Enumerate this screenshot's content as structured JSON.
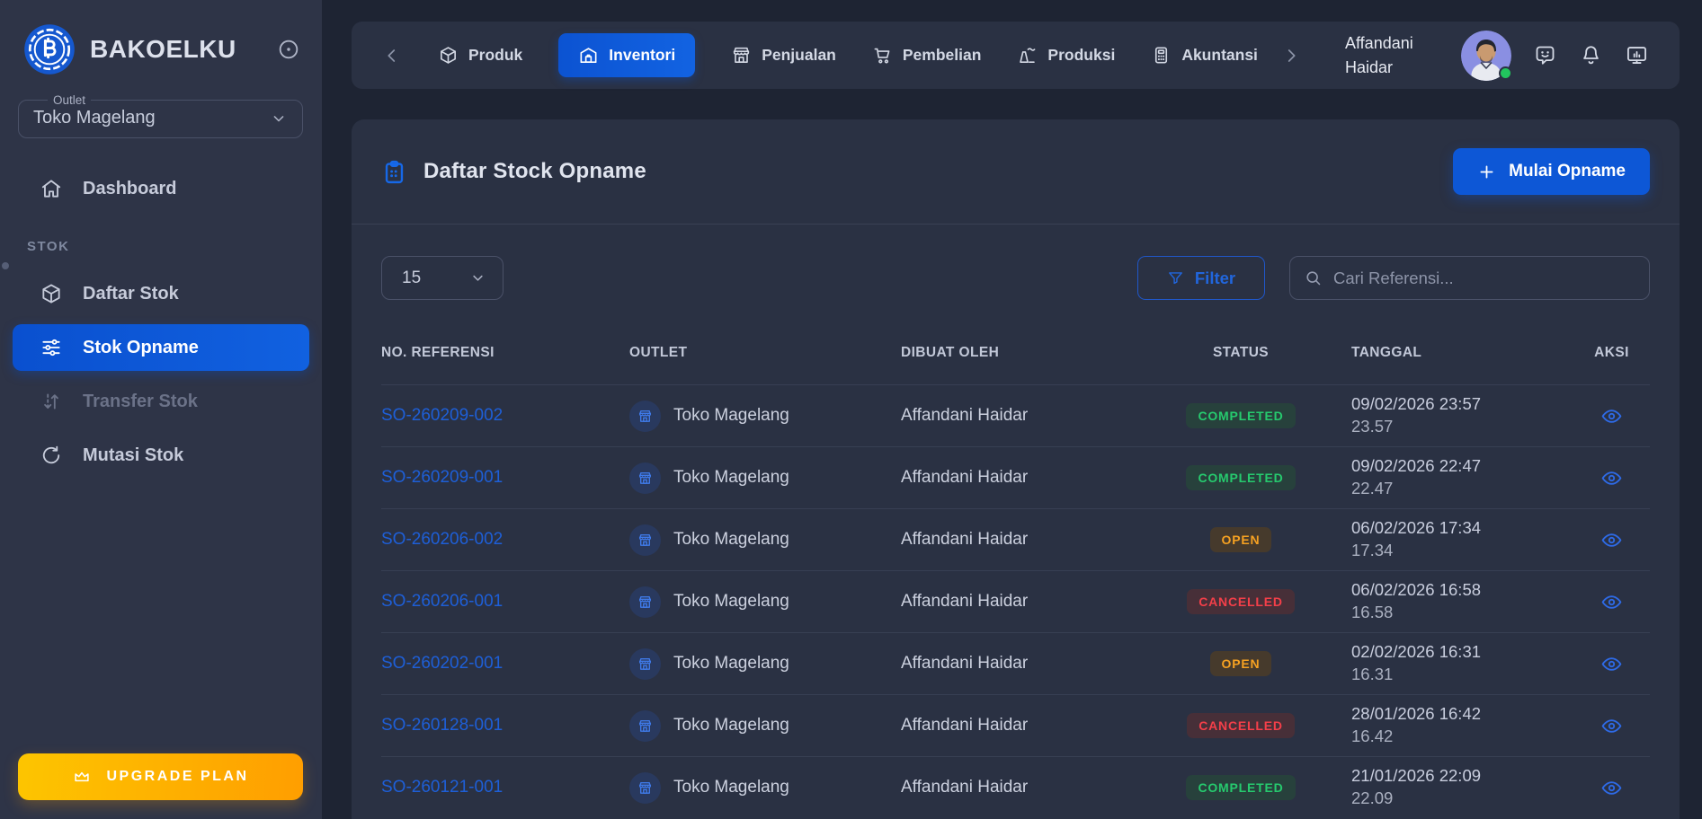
{
  "brand": {
    "name": "BAKOELKU"
  },
  "sidebar": {
    "outlet": {
      "label": "Outlet",
      "value": "Toko Magelang",
      "icon": "chevron-down-icon"
    },
    "dashboard": {
      "label": "Dashboard",
      "icon": "home-icon",
      "state": "default"
    },
    "section_label": "STOK",
    "items": [
      {
        "label": "Daftar Stok",
        "icon": "cube-icon",
        "state": "default"
      },
      {
        "label": "Stok Opname",
        "icon": "sliders-icon",
        "state": "active"
      },
      {
        "label": "Transfer Stok",
        "icon": "transfer-icon",
        "state": "disabled"
      },
      {
        "label": "Mutasi Stok",
        "icon": "refresh-icon",
        "state": "default"
      }
    ],
    "upgrade_label": "UPGRADE PLAN",
    "upgrade_icon": "crown-icon"
  },
  "topnav": {
    "items": [
      {
        "label": "Produk",
        "icon": "cube-icon",
        "active": false
      },
      {
        "label": "Inventori",
        "icon": "warehouse-icon",
        "active": true
      },
      {
        "label": "Penjualan",
        "icon": "storefront-icon",
        "active": false
      },
      {
        "label": "Pembelian",
        "icon": "cart-icon",
        "active": false
      },
      {
        "label": "Produksi",
        "icon": "factory-icon",
        "active": false
      },
      {
        "label": "Akuntansi",
        "icon": "calculator-icon",
        "active": false
      }
    ],
    "user": {
      "name": "Affandani Haidar",
      "status": "online"
    },
    "action_icons": [
      "chat-feedback-icon",
      "bell-icon",
      "display-icon"
    ]
  },
  "main": {
    "title": "Daftar Stock Opname",
    "title_icon": "clipboard-icon",
    "primary_button_label": "Mulai Opname",
    "page_size": "15",
    "filter_label": "Filter",
    "search_placeholder": "Cari Referensi...",
    "table": {
      "columns": [
        "NO. REFERENSI",
        "OUTLET",
        "DIBUAT OLEH",
        "STATUS",
        "TANGGAL",
        "AKSI"
      ],
      "rows": [
        {
          "ref": "SO-260209-002",
          "outlet": "Toko Magelang",
          "created_by": "Affandani Haidar",
          "status": "COMPLETED",
          "date": "09/02/2026 23:57",
          "time": "23.57"
        },
        {
          "ref": "SO-260209-001",
          "outlet": "Toko Magelang",
          "created_by": "Affandani Haidar",
          "status": "COMPLETED",
          "date": "09/02/2026 22:47",
          "time": "22.47"
        },
        {
          "ref": "SO-260206-002",
          "outlet": "Toko Magelang",
          "created_by": "Affandani Haidar",
          "status": "OPEN",
          "date": "06/02/2026 17:34",
          "time": "17.34"
        },
        {
          "ref": "SO-260206-001",
          "outlet": "Toko Magelang",
          "created_by": "Affandani Haidar",
          "status": "CANCELLED",
          "date": "06/02/2026 16:58",
          "time": "16.58"
        },
        {
          "ref": "SO-260202-001",
          "outlet": "Toko Magelang",
          "created_by": "Affandani Haidar",
          "status": "OPEN",
          "date": "02/02/2026 16:31",
          "time": "16.31"
        },
        {
          "ref": "SO-260128-001",
          "outlet": "Toko Magelang",
          "created_by": "Affandani Haidar",
          "status": "CANCELLED",
          "date": "28/01/2026 16:42",
          "time": "16.42"
        },
        {
          "ref": "SO-260121-001",
          "outlet": "Toko Magelang",
          "created_by": "Affandani Haidar",
          "status": "COMPLETED",
          "date": "21/01/2026 22:09",
          "time": "22.09"
        }
      ]
    }
  },
  "colors": {
    "accent_blue": "#0d57d6",
    "link_blue": "#1e5fd8",
    "status_completed": "#26ca6e",
    "status_open": "#f5a122",
    "status_cancelled": "#f43f49",
    "upgrade_gradient_start": "#fdc500",
    "upgrade_gradient_end": "#ff9e00",
    "sidebar_bg": "#2e3447",
    "card_bg": "#2a3143",
    "page_bg": "#1e2433",
    "online_dot": "#22c55e"
  }
}
